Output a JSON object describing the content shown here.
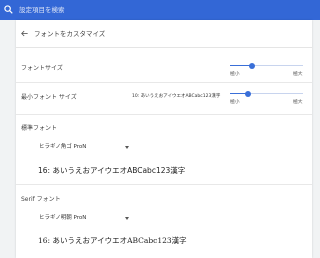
{
  "search": {
    "placeholder": "設定項目を検索"
  },
  "page": {
    "title": "フォントをカスタマイズ"
  },
  "font_size": {
    "label": "フォントサイズ",
    "min_label": "極小",
    "max_label": "極大",
    "value_fraction": 0.3
  },
  "min_font_size": {
    "label": "最小フォント サイズ",
    "preview": "10: あいうえおアイウエオABCabc123漢字",
    "min_label": "極小",
    "max_label": "極大",
    "value_fraction": 0.25
  },
  "standard_font": {
    "label": "標準フォント",
    "selected": "ヒラギノ角ゴ ProN",
    "sample": "16: あいうえおアイウエオABCabc123漢字"
  },
  "serif_font": {
    "label": "Serif フォント",
    "selected": "ヒラギノ明朝 ProN",
    "sample": "16: あいうえおアイウエオABCabc123漢字"
  },
  "colors": {
    "topbar": "#3367d6",
    "accent": "#3a6fd8"
  }
}
